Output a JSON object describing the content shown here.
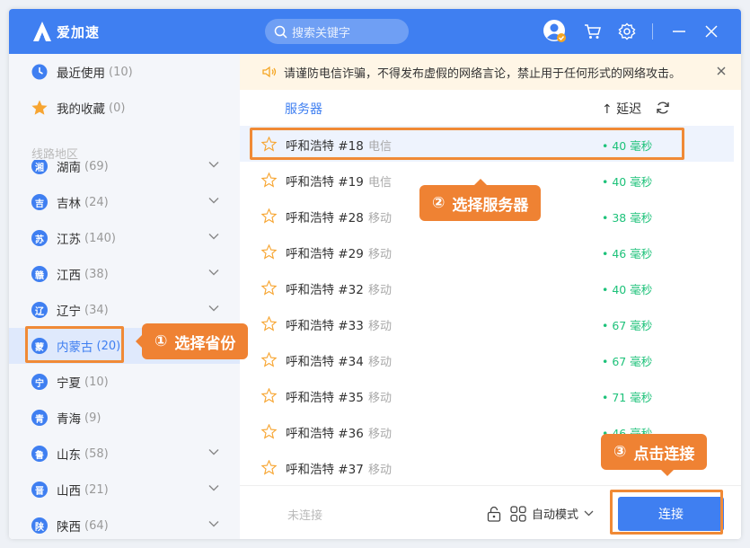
{
  "app": {
    "name": "爱加速"
  },
  "search": {
    "placeholder": "搜索关键字"
  },
  "sidebar": {
    "top_items": [
      {
        "label": "最近使用",
        "count": "(10)"
      },
      {
        "label": "我的收藏",
        "count": "(0)"
      }
    ],
    "section_label": "线路地区",
    "provinces": [
      {
        "badge": "湘",
        "label": "湖南",
        "count": "(69)"
      },
      {
        "badge": "吉",
        "label": "吉林",
        "count": "(24)"
      },
      {
        "badge": "苏",
        "label": "江苏",
        "count": "(140)"
      },
      {
        "badge": "赣",
        "label": "江西",
        "count": "(38)"
      },
      {
        "badge": "辽",
        "label": "辽宁",
        "count": "(34)"
      },
      {
        "badge": "蒙",
        "label": "内蒙古",
        "count": "(20)"
      },
      {
        "badge": "宁",
        "label": "宁夏",
        "count": "(10)"
      },
      {
        "badge": "青",
        "label": "青海",
        "count": "(9)"
      },
      {
        "badge": "鲁",
        "label": "山东",
        "count": "(58)"
      },
      {
        "badge": "晋",
        "label": "山西",
        "count": "(21)"
      },
      {
        "badge": "陕",
        "label": "陕西",
        "count": "(64)"
      }
    ]
  },
  "notice": {
    "text": "请谨防电信诈骗，不得发布虚假的网络言论，禁止用于任何形式的网络攻击。"
  },
  "list": {
    "col_server": "服务器",
    "col_delay": "↑ 延迟",
    "servers": [
      {
        "name": "呼和浩特 #18",
        "isp": "电信",
        "delay": "• 40 毫秒"
      },
      {
        "name": "呼和浩特 #19",
        "isp": "电信",
        "delay": "• 40 毫秒"
      },
      {
        "name": "呼和浩特 #28",
        "isp": "移动",
        "delay": "• 38 毫秒"
      },
      {
        "name": "呼和浩特 #29",
        "isp": "移动",
        "delay": "• 46 毫秒"
      },
      {
        "name": "呼和浩特 #32",
        "isp": "移动",
        "delay": "• 40 毫秒"
      },
      {
        "name": "呼和浩特 #33",
        "isp": "移动",
        "delay": "• 67 毫秒"
      },
      {
        "name": "呼和浩特 #34",
        "isp": "移动",
        "delay": "• 67 毫秒"
      },
      {
        "name": "呼和浩特 #35",
        "isp": "移动",
        "delay": "• 71 毫秒"
      },
      {
        "name": "呼和浩特 #36",
        "isp": "移动",
        "delay": "• 46 毫秒"
      },
      {
        "name": "呼和浩特 #37",
        "isp": "移动",
        "delay": ""
      }
    ]
  },
  "footer": {
    "status": "未连接",
    "mode": "自动模式",
    "connect": "连接"
  },
  "annotations": {
    "step1": {
      "num": "①",
      "text": "选择省份"
    },
    "step2": {
      "num": "②",
      "text": "选择服务器"
    },
    "step3": {
      "num": "③",
      "text": "点击连接"
    }
  },
  "colors": {
    "brand": "#3f7ff1",
    "accent": "#ef8233",
    "latency": "#1ec27a"
  }
}
